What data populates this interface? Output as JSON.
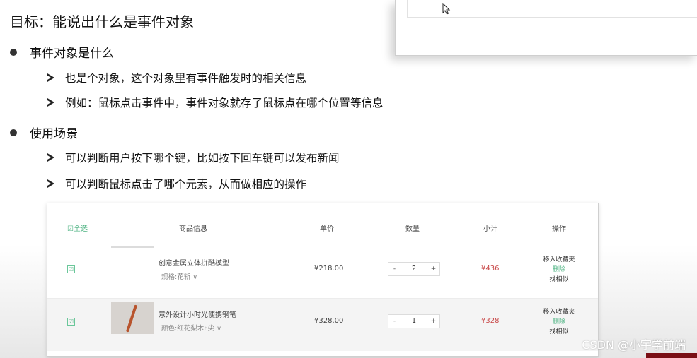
{
  "slide": {
    "title": "目标：能说出什么是事件对象",
    "sections": [
      {
        "heading": "事件对象是什么",
        "items": [
          "也是个对象，这个对象里有事件触发时的相关信息",
          "例如：鼠标点击事件中，事件对象就存了鼠标点在哪个位置等信息"
        ]
      },
      {
        "heading": "使用场景",
        "items": [
          "可以判断用户按下哪个键，比如按下回车键可以发布新闻",
          "可以判断鼠标点击了哪个元素，从而做相应的操作"
        ]
      }
    ]
  },
  "cart": {
    "headers": {
      "select_all": "☑全选",
      "product": "商品信息",
      "price": "单价",
      "quantity": "数量",
      "subtotal": "小计",
      "actions": "操作"
    },
    "rows": [
      {
        "checked": "☑",
        "name": "创意金属立体拼酷模型",
        "spec": "规格:花斩 ∨",
        "price": "¥218.00",
        "qty": "2",
        "subtotal": "¥436",
        "op_fav": "移入收藏夹",
        "op_del": "删除",
        "op_similar": "找相似"
      },
      {
        "checked": "☑",
        "name": "意外设计小时光便携钢笔",
        "spec": "颜色:红花梨木F尖 ∨",
        "price": "¥328.00",
        "qty": "1",
        "subtotal": "¥328",
        "op_fav": "移入收藏夹",
        "op_del": "删除",
        "op_similar": "找相似"
      }
    ],
    "minus": "-",
    "plus": "+"
  },
  "watermark": "CSDN @小宇学前端"
}
